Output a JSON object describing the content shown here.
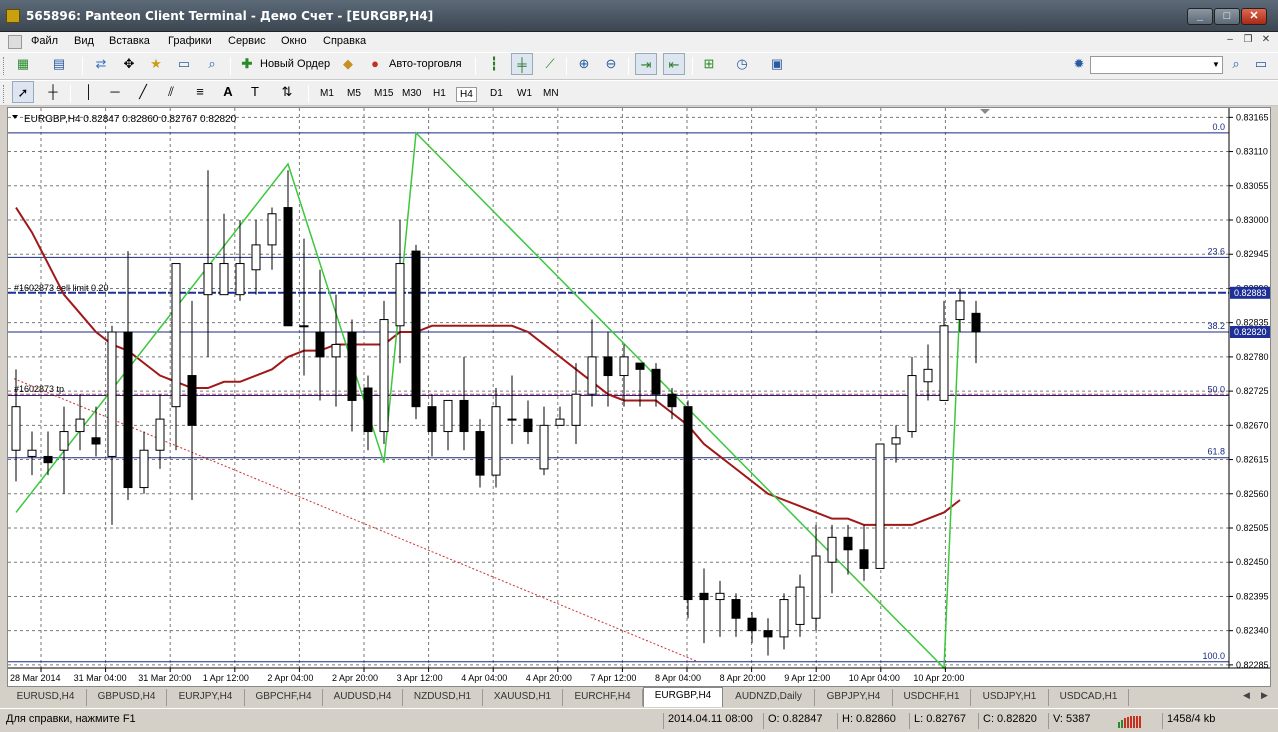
{
  "window": {
    "title": "565896: Panteon Client Terminal - Демо Счет - [EURGBP,H4]"
  },
  "menu": [
    "Файл",
    "Вид",
    "Вставка",
    "Графики",
    "Сервис",
    "Окно",
    "Справка"
  ],
  "toolbar": {
    "new_order": "Новый Ордер",
    "auto_trading": "Авто-торговля"
  },
  "timeframes": [
    "M1",
    "M5",
    "M15",
    "M30",
    "H1",
    "H4",
    "D1",
    "W1",
    "MN"
  ],
  "active_timeframe": "H4",
  "chart_data": {
    "type": "candlestick",
    "symbol_info": "EURGBP,H4  0.82847 0.82860 0.82767 0.82820",
    "ylim": [
      0.8228,
      0.8318
    ],
    "y_ticks": [
      "0.83165",
      "0.83110",
      "0.83055",
      "0.83000",
      "0.82945",
      "0.82890",
      "0.82835",
      "0.82780",
      "0.82725",
      "0.82670",
      "0.82615",
      "0.82560",
      "0.82505",
      "0.82450",
      "0.82395",
      "0.82340",
      "0.82285"
    ],
    "x_ticks": [
      "28 Mar 2014",
      "31 Mar 04:00",
      "31 Mar 20:00",
      "1 Apr 12:00",
      "2 Apr 04:00",
      "2 Apr 20:00",
      "3 Apr 12:00",
      "4 Apr 04:00",
      "4 Apr 20:00",
      "7 Apr 12:00",
      "8 Apr 04:00",
      "8 Apr 20:00",
      "9 Apr 12:00",
      "10 Apr 04:00",
      "10 Apr 20:00"
    ],
    "candles": [
      [
        0.8263,
        0.8276,
        0.8258,
        0.827
      ],
      [
        0.8262,
        0.8266,
        0.8259,
        0.8263
      ],
      [
        0.8262,
        0.8266,
        0.8259,
        0.8261
      ],
      [
        0.8263,
        0.827,
        0.8256,
        0.8266
      ],
      [
        0.8266,
        0.8272,
        0.8263,
        0.8268
      ],
      [
        0.8265,
        0.827,
        0.8262,
        0.8264
      ],
      [
        0.8262,
        0.8283,
        0.8251,
        0.8282
      ],
      [
        0.8282,
        0.8295,
        0.8255,
        0.8257
      ],
      [
        0.8257,
        0.8266,
        0.8256,
        0.8263
      ],
      [
        0.8263,
        0.8272,
        0.826,
        0.8268
      ],
      [
        0.827,
        0.8289,
        0.8263,
        0.8293
      ],
      [
        0.8275,
        0.8287,
        0.8255,
        0.8267
      ],
      [
        0.8288,
        0.8308,
        0.8278,
        0.8293
      ],
      [
        0.8288,
        0.8301,
        0.8288,
        0.8293
      ],
      [
        0.8288,
        0.83,
        0.8287,
        0.8293
      ],
      [
        0.8292,
        0.83,
        0.8288,
        0.8296
      ],
      [
        0.8296,
        0.8302,
        0.8292,
        0.8301
      ],
      [
        0.8302,
        0.8308,
        0.8283,
        0.8283
      ],
      [
        0.8283,
        0.8297,
        0.8275,
        0.8283
      ],
      [
        0.8282,
        0.8292,
        0.8271,
        0.8278
      ],
      [
        0.8278,
        0.8288,
        0.827,
        0.828
      ],
      [
        0.8282,
        0.8284,
        0.8266,
        0.8271
      ],
      [
        0.8273,
        0.8275,
        0.8263,
        0.8266
      ],
      [
        0.8266,
        0.8287,
        0.8264,
        0.8284
      ],
      [
        0.8283,
        0.83,
        0.8277,
        0.8293
      ],
      [
        0.8295,
        0.8296,
        0.8268,
        0.827
      ],
      [
        0.827,
        0.8272,
        0.8262,
        0.8266
      ],
      [
        0.8266,
        0.827,
        0.8263,
        0.8271
      ],
      [
        0.8271,
        0.8278,
        0.8263,
        0.8266
      ],
      [
        0.8266,
        0.8268,
        0.8257,
        0.8259
      ],
      [
        0.8259,
        0.8273,
        0.8257,
        0.827
      ],
      [
        0.8268,
        0.8275,
        0.8264,
        0.8268
      ],
      [
        0.8268,
        0.8271,
        0.8264,
        0.8266
      ],
      [
        0.826,
        0.827,
        0.8259,
        0.8267
      ],
      [
        0.8267,
        0.827,
        0.8267,
        0.8268
      ],
      [
        0.8267,
        0.8277,
        0.8264,
        0.8272
      ],
      [
        0.8272,
        0.8284,
        0.827,
        0.8278
      ],
      [
        0.8278,
        0.8282,
        0.827,
        0.8275
      ],
      [
        0.8275,
        0.828,
        0.827,
        0.8278
      ],
      [
        0.8277,
        0.8277,
        0.827,
        0.8276
      ],
      [
        0.8276,
        0.8277,
        0.827,
        0.8272
      ],
      [
        0.8272,
        0.8273,
        0.8268,
        0.827
      ],
      [
        0.827,
        0.8271,
        0.8236,
        0.8239
      ],
      [
        0.824,
        0.8244,
        0.8232,
        0.8239
      ],
      [
        0.8239,
        0.8242,
        0.8233,
        0.824
      ],
      [
        0.8239,
        0.824,
        0.8233,
        0.8236
      ],
      [
        0.8236,
        0.8237,
        0.8232,
        0.8234
      ],
      [
        0.8234,
        0.8236,
        0.823,
        0.8233
      ],
      [
        0.8233,
        0.824,
        0.8231,
        0.8239
      ],
      [
        0.8235,
        0.8243,
        0.8233,
        0.8241
      ],
      [
        0.8236,
        0.8251,
        0.8234,
        0.8246
      ],
      [
        0.8245,
        0.8251,
        0.824,
        0.8249
      ],
      [
        0.8249,
        0.8251,
        0.8243,
        0.8247
      ],
      [
        0.8247,
        0.8251,
        0.8242,
        0.8244
      ],
      [
        0.8244,
        0.8262,
        0.8244,
        0.8264
      ],
      [
        0.8264,
        0.8267,
        0.8261,
        0.8265
      ],
      [
        0.8266,
        0.8278,
        0.8265,
        0.8275
      ],
      [
        0.8274,
        0.828,
        0.8271,
        0.8276
      ],
      [
        0.8271,
        0.8287,
        0.8271,
        0.8283
      ],
      [
        0.8284,
        0.8289,
        0.8282,
        0.8287
      ],
      [
        0.8285,
        0.8287,
        0.8277,
        0.8282
      ]
    ],
    "moving_average": [
      0.8302,
      0.8298,
      0.8293,
      0.8288,
      0.8285,
      0.8282,
      0.828,
      0.8279,
      0.8277,
      0.8275,
      0.8274,
      0.8273,
      0.8273,
      0.8274,
      0.8274,
      0.8275,
      0.8276,
      0.8278,
      0.8279,
      0.8279,
      0.828,
      0.828,
      0.828,
      0.828,
      0.8282,
      0.8282,
      0.8283,
      0.8283,
      0.8283,
      0.8283,
      0.8283,
      0.8283,
      0.8282,
      0.828,
      0.8278,
      0.8276,
      0.8274,
      0.8272,
      0.8271,
      0.8271,
      0.8271,
      0.8269,
      0.8267,
      0.8264,
      0.8262,
      0.826,
      0.8258,
      0.8256,
      0.8255,
      0.8254,
      0.8253,
      0.8252,
      0.8252,
      0.8251,
      0.8251,
      0.8251,
      0.8251,
      0.8252,
      0.8253,
      0.8255
    ],
    "zigzag": [
      [
        0,
        0.8253
      ],
      [
        17,
        0.8309
      ],
      [
        23,
        0.8261
      ],
      [
        25,
        0.8314
      ],
      [
        58,
        0.8228
      ],
      [
        59,
        0.8287
      ]
    ],
    "fibo_levels": [
      {
        "label": "0.0",
        "value": 0.8314
      },
      {
        "label": "23.6",
        "value": 0.8294
      },
      {
        "label": "38.2",
        "value": 0.8282
      },
      {
        "label": "50.0",
        "value": 0.82718
      },
      {
        "label": "61.8",
        "value": 0.82618
      },
      {
        "label": "100.0",
        "value": 0.8229
      }
    ],
    "orders": [
      {
        "label": "#1602873 sell limit 0.20",
        "value": 0.82883
      },
      {
        "label": "#1602873 tp",
        "value": 0.8272
      }
    ],
    "price_labels": [
      {
        "text": "0.82883",
        "value": 0.82883
      },
      {
        "text": "0.82820",
        "value": 0.8282
      }
    ]
  },
  "symbol_tabs": [
    "EURUSD,H4",
    "GBPUSD,H4",
    "EURJPY,H4",
    "GBPCHF,H4",
    "AUDUSD,H4",
    "NZDUSD,H1",
    "XAUUSD,H1",
    "EURCHF,H4",
    "EURGBP,H4",
    "AUDNZD,Daily",
    "GBPJPY,H4",
    "USDCHF,H1",
    "USDJPY,H1",
    "USDCAD,H1"
  ],
  "active_tab": "EURGBP,H4",
  "status": {
    "help": "Для справки, нажмите F1",
    "datetime": "2014.04.11 08:00",
    "open": "O: 0.82847",
    "high": "H: 0.82860",
    "low": "L: 0.82767",
    "close": "C: 0.82820",
    "volume": "V: 5387",
    "traffic": "1458/4 kb"
  },
  "colors": {
    "grid": "#7a7a7a",
    "candle_line": "#000000",
    "zigzag": "#3cc83c",
    "ma": "#a01818",
    "level": "#1a2a80",
    "order_line": "#1e2f98",
    "tp_line": "#e03a5a"
  }
}
